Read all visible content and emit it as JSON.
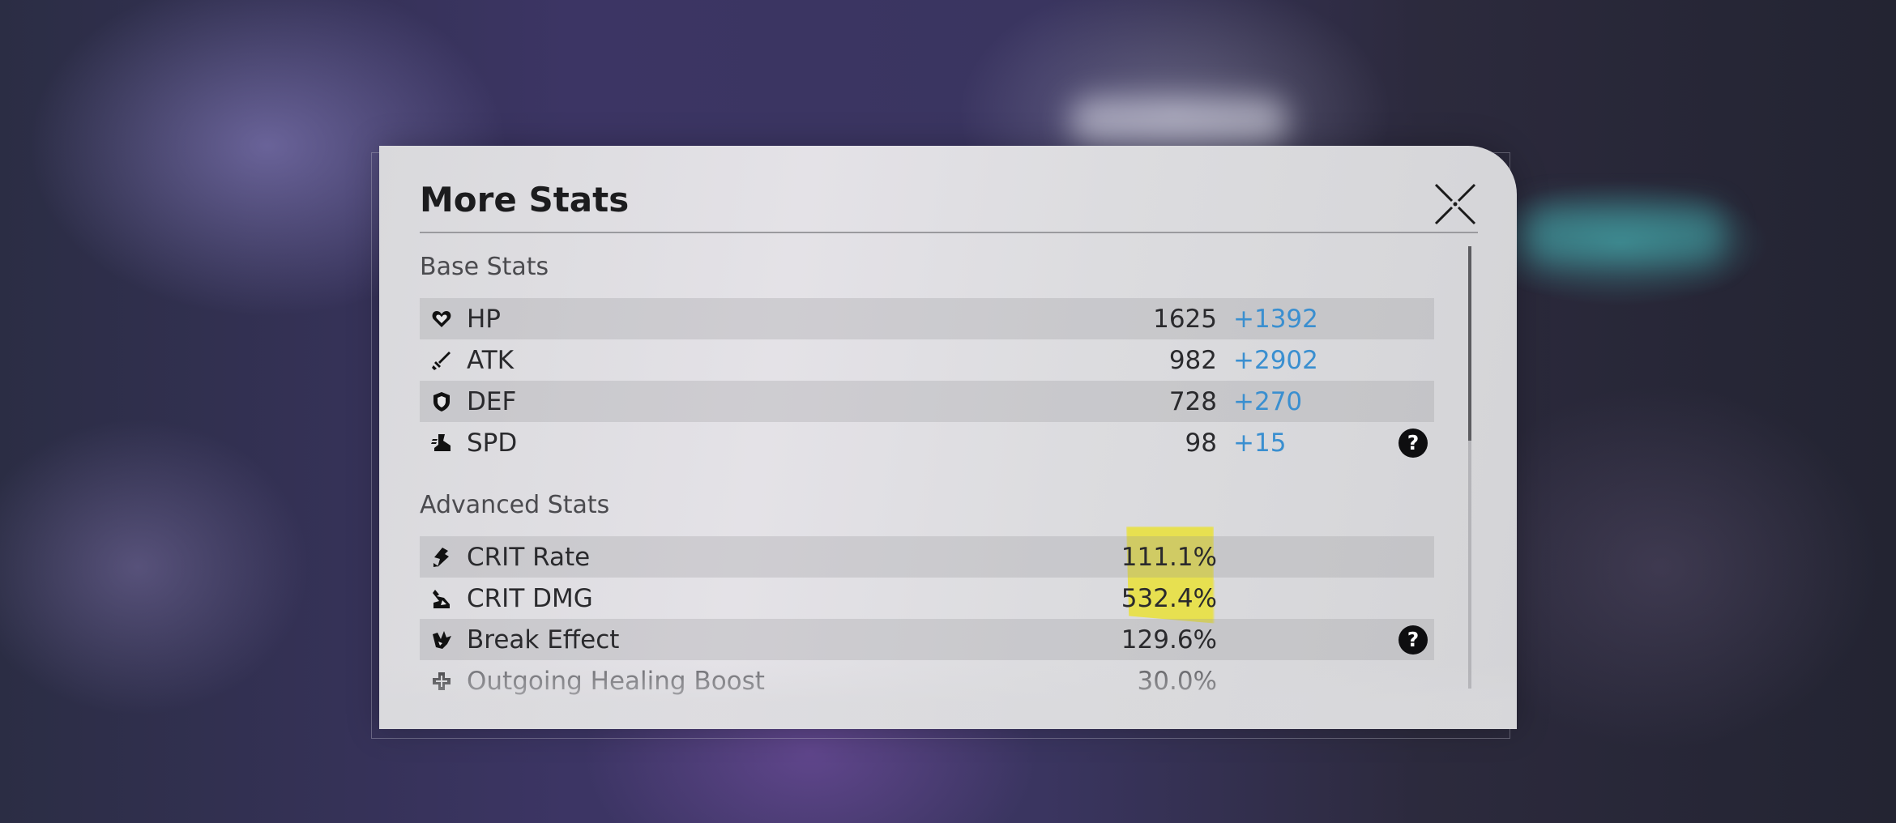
{
  "dialog": {
    "title": "More Stats",
    "close_icon": "close-x-icon"
  },
  "base_stats": {
    "label": "Base Stats",
    "rows": [
      {
        "icon": "hp-heart-icon",
        "name": "HP",
        "base": "1625",
        "bonus": "+1392"
      },
      {
        "icon": "atk-sword-icon",
        "name": "ATK",
        "base": "982",
        "bonus": "+2902"
      },
      {
        "icon": "def-shield-icon",
        "name": "DEF",
        "base": "728",
        "bonus": "+270"
      },
      {
        "icon": "spd-boot-icon",
        "name": "SPD",
        "base": "98",
        "bonus": "+15",
        "help": "?"
      }
    ]
  },
  "advanced_stats": {
    "label": "Advanced Stats",
    "rows": [
      {
        "icon": "crit-rate-icon",
        "name": "CRIT Rate",
        "value": "111.1%"
      },
      {
        "icon": "crit-dmg-icon",
        "name": "CRIT DMG",
        "value": "532.4%"
      },
      {
        "icon": "break-effect-icon",
        "name": "Break Effect",
        "value": "129.6%",
        "help": "?"
      },
      {
        "icon": "healing-cross-icon",
        "name": "Outgoing Healing Boost",
        "value": "30.0%"
      }
    ]
  },
  "colors": {
    "bonus": "#3a8fd0",
    "highlight": "#ebe128"
  }
}
